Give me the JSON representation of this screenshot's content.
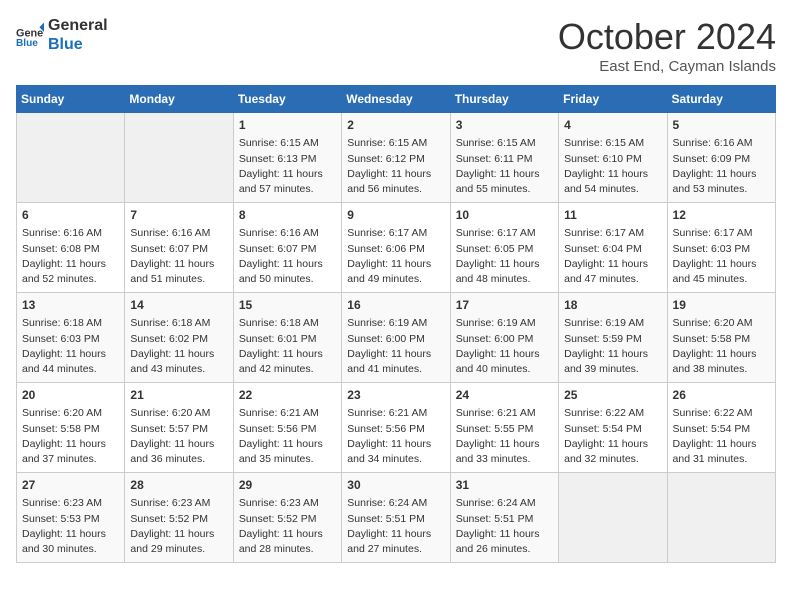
{
  "header": {
    "logo_line1": "General",
    "logo_line2": "Blue",
    "month": "October 2024",
    "location": "East End, Cayman Islands"
  },
  "days_of_week": [
    "Sunday",
    "Monday",
    "Tuesday",
    "Wednesday",
    "Thursday",
    "Friday",
    "Saturday"
  ],
  "weeks": [
    [
      {
        "day": "",
        "empty": true
      },
      {
        "day": "",
        "empty": true
      },
      {
        "day": "1",
        "sunrise": "Sunrise: 6:15 AM",
        "sunset": "Sunset: 6:13 PM",
        "daylight": "Daylight: 11 hours and 57 minutes."
      },
      {
        "day": "2",
        "sunrise": "Sunrise: 6:15 AM",
        "sunset": "Sunset: 6:12 PM",
        "daylight": "Daylight: 11 hours and 56 minutes."
      },
      {
        "day": "3",
        "sunrise": "Sunrise: 6:15 AM",
        "sunset": "Sunset: 6:11 PM",
        "daylight": "Daylight: 11 hours and 55 minutes."
      },
      {
        "day": "4",
        "sunrise": "Sunrise: 6:15 AM",
        "sunset": "Sunset: 6:10 PM",
        "daylight": "Daylight: 11 hours and 54 minutes."
      },
      {
        "day": "5",
        "sunrise": "Sunrise: 6:16 AM",
        "sunset": "Sunset: 6:09 PM",
        "daylight": "Daylight: 11 hours and 53 minutes."
      }
    ],
    [
      {
        "day": "6",
        "sunrise": "Sunrise: 6:16 AM",
        "sunset": "Sunset: 6:08 PM",
        "daylight": "Daylight: 11 hours and 52 minutes."
      },
      {
        "day": "7",
        "sunrise": "Sunrise: 6:16 AM",
        "sunset": "Sunset: 6:07 PM",
        "daylight": "Daylight: 11 hours and 51 minutes."
      },
      {
        "day": "8",
        "sunrise": "Sunrise: 6:16 AM",
        "sunset": "Sunset: 6:07 PM",
        "daylight": "Daylight: 11 hours and 50 minutes."
      },
      {
        "day": "9",
        "sunrise": "Sunrise: 6:17 AM",
        "sunset": "Sunset: 6:06 PM",
        "daylight": "Daylight: 11 hours and 49 minutes."
      },
      {
        "day": "10",
        "sunrise": "Sunrise: 6:17 AM",
        "sunset": "Sunset: 6:05 PM",
        "daylight": "Daylight: 11 hours and 48 minutes."
      },
      {
        "day": "11",
        "sunrise": "Sunrise: 6:17 AM",
        "sunset": "Sunset: 6:04 PM",
        "daylight": "Daylight: 11 hours and 47 minutes."
      },
      {
        "day": "12",
        "sunrise": "Sunrise: 6:17 AM",
        "sunset": "Sunset: 6:03 PM",
        "daylight": "Daylight: 11 hours and 45 minutes."
      }
    ],
    [
      {
        "day": "13",
        "sunrise": "Sunrise: 6:18 AM",
        "sunset": "Sunset: 6:03 PM",
        "daylight": "Daylight: 11 hours and 44 minutes."
      },
      {
        "day": "14",
        "sunrise": "Sunrise: 6:18 AM",
        "sunset": "Sunset: 6:02 PM",
        "daylight": "Daylight: 11 hours and 43 minutes."
      },
      {
        "day": "15",
        "sunrise": "Sunrise: 6:18 AM",
        "sunset": "Sunset: 6:01 PM",
        "daylight": "Daylight: 11 hours and 42 minutes."
      },
      {
        "day": "16",
        "sunrise": "Sunrise: 6:19 AM",
        "sunset": "Sunset: 6:00 PM",
        "daylight": "Daylight: 11 hours and 41 minutes."
      },
      {
        "day": "17",
        "sunrise": "Sunrise: 6:19 AM",
        "sunset": "Sunset: 6:00 PM",
        "daylight": "Daylight: 11 hours and 40 minutes."
      },
      {
        "day": "18",
        "sunrise": "Sunrise: 6:19 AM",
        "sunset": "Sunset: 5:59 PM",
        "daylight": "Daylight: 11 hours and 39 minutes."
      },
      {
        "day": "19",
        "sunrise": "Sunrise: 6:20 AM",
        "sunset": "Sunset: 5:58 PM",
        "daylight": "Daylight: 11 hours and 38 minutes."
      }
    ],
    [
      {
        "day": "20",
        "sunrise": "Sunrise: 6:20 AM",
        "sunset": "Sunset: 5:58 PM",
        "daylight": "Daylight: 11 hours and 37 minutes."
      },
      {
        "day": "21",
        "sunrise": "Sunrise: 6:20 AM",
        "sunset": "Sunset: 5:57 PM",
        "daylight": "Daylight: 11 hours and 36 minutes."
      },
      {
        "day": "22",
        "sunrise": "Sunrise: 6:21 AM",
        "sunset": "Sunset: 5:56 PM",
        "daylight": "Daylight: 11 hours and 35 minutes."
      },
      {
        "day": "23",
        "sunrise": "Sunrise: 6:21 AM",
        "sunset": "Sunset: 5:56 PM",
        "daylight": "Daylight: 11 hours and 34 minutes."
      },
      {
        "day": "24",
        "sunrise": "Sunrise: 6:21 AM",
        "sunset": "Sunset: 5:55 PM",
        "daylight": "Daylight: 11 hours and 33 minutes."
      },
      {
        "day": "25",
        "sunrise": "Sunrise: 6:22 AM",
        "sunset": "Sunset: 5:54 PM",
        "daylight": "Daylight: 11 hours and 32 minutes."
      },
      {
        "day": "26",
        "sunrise": "Sunrise: 6:22 AM",
        "sunset": "Sunset: 5:54 PM",
        "daylight": "Daylight: 11 hours and 31 minutes."
      }
    ],
    [
      {
        "day": "27",
        "sunrise": "Sunrise: 6:23 AM",
        "sunset": "Sunset: 5:53 PM",
        "daylight": "Daylight: 11 hours and 30 minutes."
      },
      {
        "day": "28",
        "sunrise": "Sunrise: 6:23 AM",
        "sunset": "Sunset: 5:52 PM",
        "daylight": "Daylight: 11 hours and 29 minutes."
      },
      {
        "day": "29",
        "sunrise": "Sunrise: 6:23 AM",
        "sunset": "Sunset: 5:52 PM",
        "daylight": "Daylight: 11 hours and 28 minutes."
      },
      {
        "day": "30",
        "sunrise": "Sunrise: 6:24 AM",
        "sunset": "Sunset: 5:51 PM",
        "daylight": "Daylight: 11 hours and 27 minutes."
      },
      {
        "day": "31",
        "sunrise": "Sunrise: 6:24 AM",
        "sunset": "Sunset: 5:51 PM",
        "daylight": "Daylight: 11 hours and 26 minutes."
      },
      {
        "day": "",
        "empty": true
      },
      {
        "day": "",
        "empty": true
      }
    ]
  ]
}
